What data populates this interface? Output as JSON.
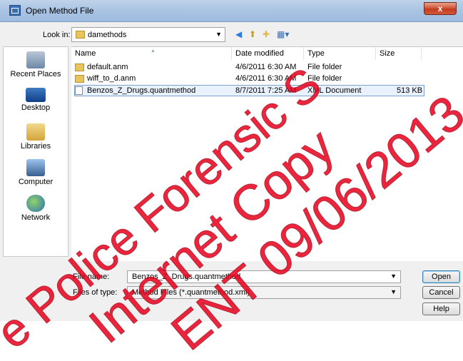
{
  "window": {
    "title": "Open Method File",
    "close_glyph": "x"
  },
  "lookin": {
    "label": "Look in:",
    "value": "damethods"
  },
  "toolbar_icons": [
    "back-icon",
    "up-folder-icon",
    "new-folder-icon",
    "views-menu-icon"
  ],
  "places": [
    {
      "label": "Recent Places",
      "icon": "recent-places-icon"
    },
    {
      "label": "Desktop",
      "icon": "desktop-icon"
    },
    {
      "label": "Libraries",
      "icon": "libraries-icon"
    },
    {
      "label": "Computer",
      "icon": "computer-icon"
    },
    {
      "label": "Network",
      "icon": "network-icon"
    }
  ],
  "columns": [
    "Name",
    "Date modified",
    "Type",
    "Size"
  ],
  "files": [
    {
      "name": "default.anm",
      "date": "4/6/2011 6:30 AM",
      "type": "File folder",
      "size": "",
      "icon": "folder-icon"
    },
    {
      "name": "wiff_to_d.anm",
      "date": "4/6/2011 6:30 AM",
      "type": "File folder",
      "size": "",
      "icon": "folder-icon"
    },
    {
      "name": "Benzos_Z_Drugs.quantmethod",
      "date": "8/7/2011 7:25 AM",
      "type": "XML Document",
      "size": "513 KB",
      "icon": "xml-document-icon",
      "selected": true
    }
  ],
  "filename": {
    "label": "File name:",
    "value": "Benzos_Z_Drugs.quantmethod"
  },
  "filetype": {
    "label": "Files of type:",
    "value": "Method Files (*.quantmethod.xml)"
  },
  "buttons": {
    "open": "Open",
    "cancel": "Cancel",
    "help": "Help"
  },
  "watermark": {
    "lines": [
      "e Police Forensic S",
      "Internet Copy",
      "ENT 09/06/2013"
    ],
    "color": "#e8001c"
  },
  "colors": {
    "selection_fill": "#e8f1fc",
    "selection_border": "#7da2ce",
    "titlebar": "#a9c3e2"
  }
}
